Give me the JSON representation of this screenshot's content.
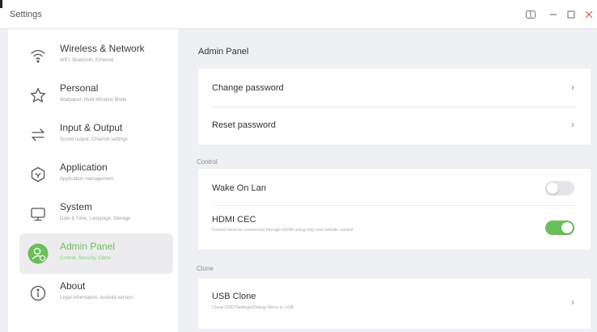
{
  "window": {
    "title": "Settings",
    "controls": [
      "mirror-icon",
      "minimize-icon",
      "maximize-icon",
      "close-icon"
    ]
  },
  "sidebar": {
    "items": [
      {
        "title": "Wireless & Network",
        "subtitle": "WiFi, Bluetooth, Ethernet",
        "icon": "wifi-icon"
      },
      {
        "title": "Personal",
        "subtitle": "Wallpaper, Multi-Window Mode",
        "icon": "star-icon"
      },
      {
        "title": "Input & Output",
        "subtitle": "Sound output, Channel settings",
        "icon": "swap-arrows-icon"
      },
      {
        "title": "Application",
        "subtitle": "Application management",
        "icon": "application-icon"
      },
      {
        "title": "System",
        "subtitle": "Date & Time, Language, Storage",
        "icon": "monitor-icon"
      },
      {
        "title": "Admin Panel",
        "subtitle": "Control, Security, Clone",
        "icon": "admin-user-icon",
        "active": true
      },
      {
        "title": "About",
        "subtitle": "Legal information, Android version",
        "icon": "info-icon"
      }
    ]
  },
  "main": {
    "heading": "Admin Panel",
    "password_card": {
      "change_password": "Change password",
      "reset_password": "Reset password"
    },
    "control_section": {
      "label": "Control",
      "wake_on_lan": {
        "label": "Wake On Lan",
        "enabled": false
      },
      "hdmi_cec": {
        "label": "HDMI CEC",
        "description": "Control devices connected through HDMI using only one remote control",
        "enabled": true
      }
    },
    "clone_section": {
      "label": "Clone",
      "usb_clone": {
        "label": "USB Clone",
        "description": "Clone OSD/Settings/Debug Menu to USB"
      }
    }
  },
  "colors": {
    "accent": "#6bbf5a",
    "background": "#eef0f3",
    "close": "#e2564f"
  }
}
